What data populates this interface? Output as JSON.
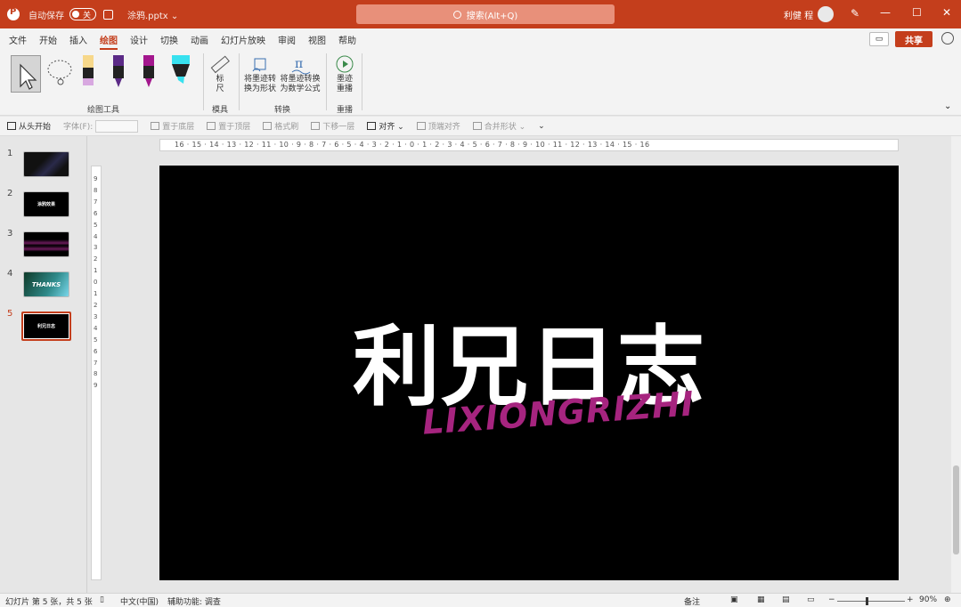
{
  "titlebar": {
    "autosave_label": "自动保存",
    "autosave_state": "关",
    "filename": "涂鸦.pptx ⌄",
    "search_placeholder": "搜索(Alt+Q)",
    "user": "利健 程",
    "min": "—",
    "max": "☐",
    "close": "✕"
  },
  "tabs": [
    "文件",
    "开始",
    "插入",
    "绘图",
    "设计",
    "切换",
    "动画",
    "幻灯片放映",
    "审阅",
    "视图",
    "帮助"
  ],
  "actions": {
    "share": "共享"
  },
  "ribbon": {
    "groups": {
      "drawing_tools": "绘图工具",
      "stencils": "模具",
      "convert": "转换",
      "replay": "重播"
    },
    "ruler_label": "标\n尺",
    "ink_to_shape": "将墨迹转\n换为形状",
    "ink_to_math": "将墨迹转换\n为数学公式",
    "ink_replay": "墨迹\n重播",
    "pen_colors": [
      "#f7d88a",
      "#5b2a86",
      "#a3168d",
      "#38e1ef"
    ]
  },
  "qat": {
    "from_start": "从头开始",
    "font": "字体(F):",
    "send_back": "置于底层",
    "bring_front": "置于顶层",
    "format_painter": "格式刷",
    "move_down": "下移一层",
    "align": "对齐 ⌄",
    "top_align": "顶端对齐",
    "merge_shapes": "合并形状 ⌄",
    "more": "⌄"
  },
  "slides": [
    {
      "num": "1",
      "label": ""
    },
    {
      "num": "2",
      "label": "涂鸦效果"
    },
    {
      "num": "3",
      "label": ""
    },
    {
      "num": "4",
      "label": "THANKS"
    },
    {
      "num": "5",
      "label": "利兄日志"
    }
  ],
  "canvas": {
    "title": "利兄日志",
    "subtitle": "LIXIONGRIZHI",
    "hruler": "16 · 15 · 14 · 13 · 12 · 11 · 10 · 9 · 8 · 7 · 6 · 5 · 4 · 3 · 2 · 1 · 0 · 1 · 2 · 3 · 4 · 5 · 6 · 7 · 8 · 9 · 10 · 11 · 12 · 13 · 14 · 15 · 16",
    "vruler": "9 8 7 6 5 4 3 2 1 0 1 2 3 4 5 6 7 8 9"
  },
  "status": {
    "slide_info": "幻灯片 第 5 张，共 5 张",
    "language": "中文(中国)",
    "accessibility": "辅助功能: 调查",
    "notes": "备注",
    "zoom": "90%"
  }
}
